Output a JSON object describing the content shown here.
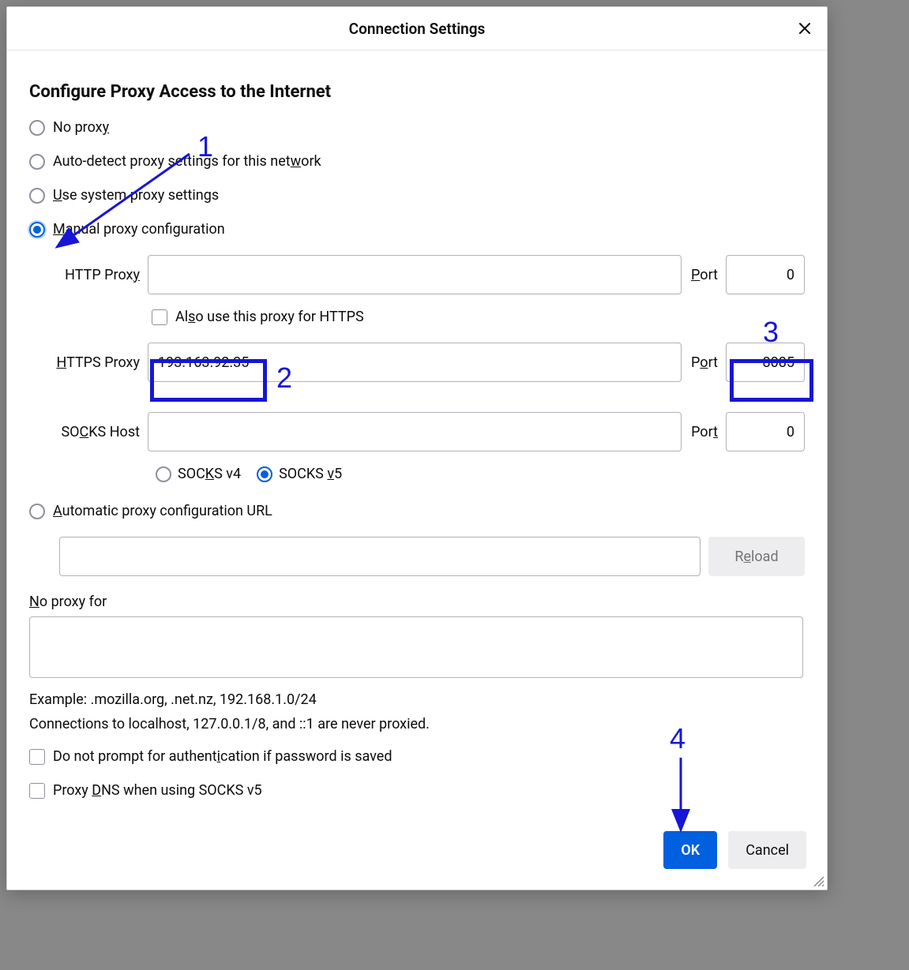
{
  "dialog": {
    "title": "Connection Settings",
    "section_heading": "Configure Proxy Access to the Internet"
  },
  "radios": {
    "no_proxy": "No proxy",
    "auto_detect": "Auto-detect proxy settings for this network",
    "system": "Use system proxy settings",
    "manual": "Manual proxy configuration",
    "auto_url": "Automatic proxy configuration URL"
  },
  "labels": {
    "http_proxy": "HTTP Proxy",
    "https_proxy": "HTTPS Proxy",
    "socks_host": "SOCKS Host",
    "port": "Port",
    "also_https": "Also use this proxy for HTTPS",
    "socks_v4": "SOCKS v4",
    "socks_v5": "SOCKS v5",
    "reload": "Reload",
    "no_proxy_for": "No proxy for",
    "example": "Example: .mozilla.org, .net.nz, 192.168.1.0/24",
    "local_note": "Connections to localhost, 127.0.0.1/8, and ::1 are never proxied.",
    "no_auth_prompt": "Do not prompt for authentication if password is saved",
    "proxy_dns": "Proxy DNS when using SOCKS v5"
  },
  "values": {
    "http_proxy": "",
    "http_port": "0",
    "https_proxy": "193.163.92.35",
    "https_port": "8085",
    "socks_host": "",
    "socks_port": "0",
    "pac_url": "",
    "no_proxy_for": ""
  },
  "buttons": {
    "ok": "OK",
    "cancel": "Cancel"
  },
  "annotations": {
    "n1": "1",
    "n2": "2",
    "n3": "3",
    "n4": "4"
  }
}
